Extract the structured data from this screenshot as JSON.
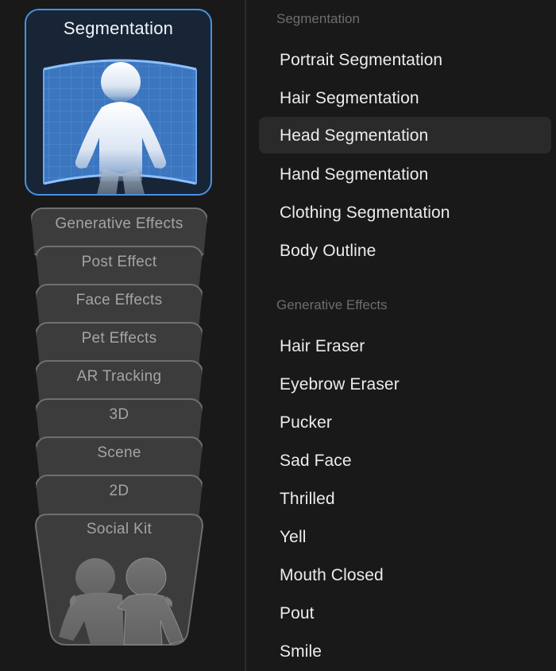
{
  "left_rail": {
    "featured": {
      "label": "Segmentation",
      "icon": "person-segmentation-icon",
      "accent_color": "#4a90e2"
    },
    "tabs": [
      {
        "label": "Generative Effects"
      },
      {
        "label": "Post Effect"
      },
      {
        "label": "Face Effects"
      },
      {
        "label": "Pet Effects"
      },
      {
        "label": "AR Tracking"
      },
      {
        "label": "3D"
      },
      {
        "label": "Scene"
      },
      {
        "label": "2D"
      },
      {
        "label": "Social Kit",
        "icon": "two-people-icon"
      }
    ]
  },
  "right_panel": {
    "sections": [
      {
        "header": "Segmentation",
        "items": [
          {
            "label": "Portrait Segmentation"
          },
          {
            "label": "Hair Segmentation"
          },
          {
            "label": "Head Segmentation",
            "selected": true
          },
          {
            "label": "Hand Segmentation"
          },
          {
            "label": "Clothing Segmentation"
          },
          {
            "label": "Body Outline"
          }
        ]
      },
      {
        "header": "Generative Effects",
        "items": [
          {
            "label": "Hair Eraser"
          },
          {
            "label": "Eyebrow Eraser"
          },
          {
            "label": "Pucker"
          },
          {
            "label": "Sad Face"
          },
          {
            "label": "Thrilled"
          },
          {
            "label": "Yell"
          },
          {
            "label": "Mouth Closed"
          },
          {
            "label": "Pout"
          },
          {
            "label": "Smile"
          }
        ]
      }
    ]
  }
}
